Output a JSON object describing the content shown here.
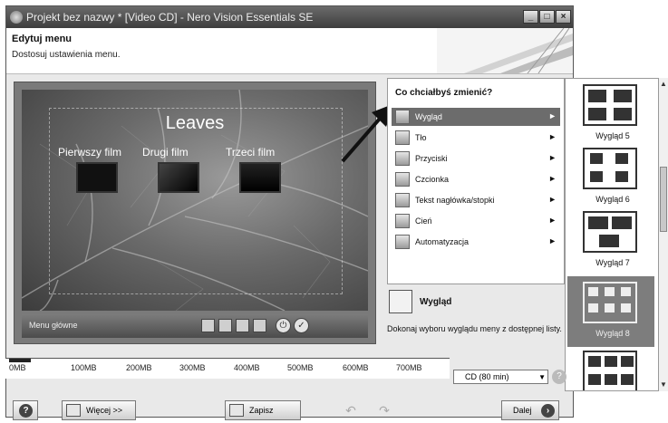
{
  "window": {
    "title": "Projekt bez nazwy * [Video CD] - Nero Vision Essentials SE"
  },
  "header": {
    "title": "Edytuj menu",
    "subtitle": "Dostosuj ustawienia menu."
  },
  "preview": {
    "menu_title": "Leaves",
    "films": [
      "Pierwszy film",
      "Drugi film",
      "Trzeci film"
    ],
    "menubar_label": "Menu główne"
  },
  "panel": {
    "question": "Co chciałbyś zmienić?",
    "options": [
      {
        "label": "Wygląd",
        "icon": "layout-icon"
      },
      {
        "label": "Tło",
        "icon": "background-icon"
      },
      {
        "label": "Przyciski",
        "icon": "buttons-icon"
      },
      {
        "label": "Czcionka",
        "icon": "font-icon"
      },
      {
        "label": "Tekst nagłówka/stopki",
        "icon": "header-footer-text-icon"
      },
      {
        "label": "Cień",
        "icon": "shadow-icon"
      },
      {
        "label": "Automatyzacja",
        "icon": "automation-icon"
      }
    ],
    "selected_name": "Wygląd",
    "selected_description": "Dokonaj wyboru wyglądu meny z dostępnej listy."
  },
  "gallery": {
    "items": [
      "Wygląd 5",
      "Wygląd 6",
      "Wygląd 7",
      "Wygląd 8"
    ],
    "selected": "Wygląd 8"
  },
  "sizebar": {
    "labels": [
      "0MB",
      "100MB",
      "200MB",
      "300MB",
      "400MB",
      "500MB",
      "600MB",
      "700MB"
    ],
    "disc_type": "CD (80 min)",
    "used_fraction": 0.05
  },
  "footer": {
    "more_label": "Więcej >>",
    "save_label": "Zapisz",
    "next_label": "Dalej"
  },
  "colors": {
    "selected": "#6c6c6c",
    "titlebar": "#4a4a4a"
  }
}
